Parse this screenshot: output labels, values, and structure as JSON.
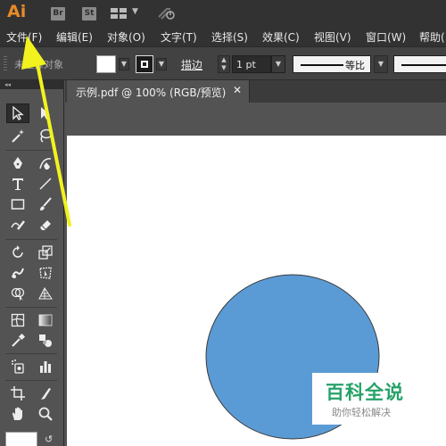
{
  "app": {
    "logo": "Ai",
    "bridge_badge": "Br",
    "stock_badge": "St",
    "accent_color": "#e88a28"
  },
  "menu": [
    {
      "label": "文件(F)"
    },
    {
      "label": "编辑(E)"
    },
    {
      "label": "对象(O)"
    },
    {
      "label": "文字(T)"
    },
    {
      "label": "选择(S)"
    },
    {
      "label": "效果(C)"
    },
    {
      "label": "视图(V)"
    },
    {
      "label": "窗口(W)"
    },
    {
      "label": "帮助("
    }
  ],
  "control_bar": {
    "selection_state": "未选择对象",
    "stroke_label": "描边",
    "stroke_weight": "1 pt",
    "profile_label": "等比"
  },
  "tools": {
    "panel_glyph": "◂◂",
    "items": [
      "selection-tool",
      "direct-selection-tool",
      "magic-wand-tool",
      "lasso-tool",
      "pen-tool",
      "curvature-tool",
      "type-tool",
      "line-segment-tool",
      "rectangle-tool",
      "paintbrush-tool",
      "shaper-tool",
      "eraser-tool",
      "rotate-tool",
      "scale-tool",
      "warp-tool",
      "free-transform-tool",
      "shape-builder-tool",
      "perspective-grid-tool",
      "mesh-tool",
      "gradient-tool",
      "eyedropper-tool",
      "blend-tool",
      "symbol-sprayer-tool",
      "column-graph-tool",
      "artboard-tool",
      "slice-tool",
      "hand-tool",
      "zoom-tool"
    ]
  },
  "document": {
    "tab_title": "示例.pdf @ 100% (RGB/预览)",
    "close_glyph": "✕",
    "shape_fill": "#5b9bd5",
    "shape_stroke": "#3a3a3a"
  },
  "watermark": {
    "title": "百科全说",
    "subtitle": "助你轻松解决",
    "color": "#26a269"
  },
  "annotation": {
    "color": "#f2f21e"
  }
}
